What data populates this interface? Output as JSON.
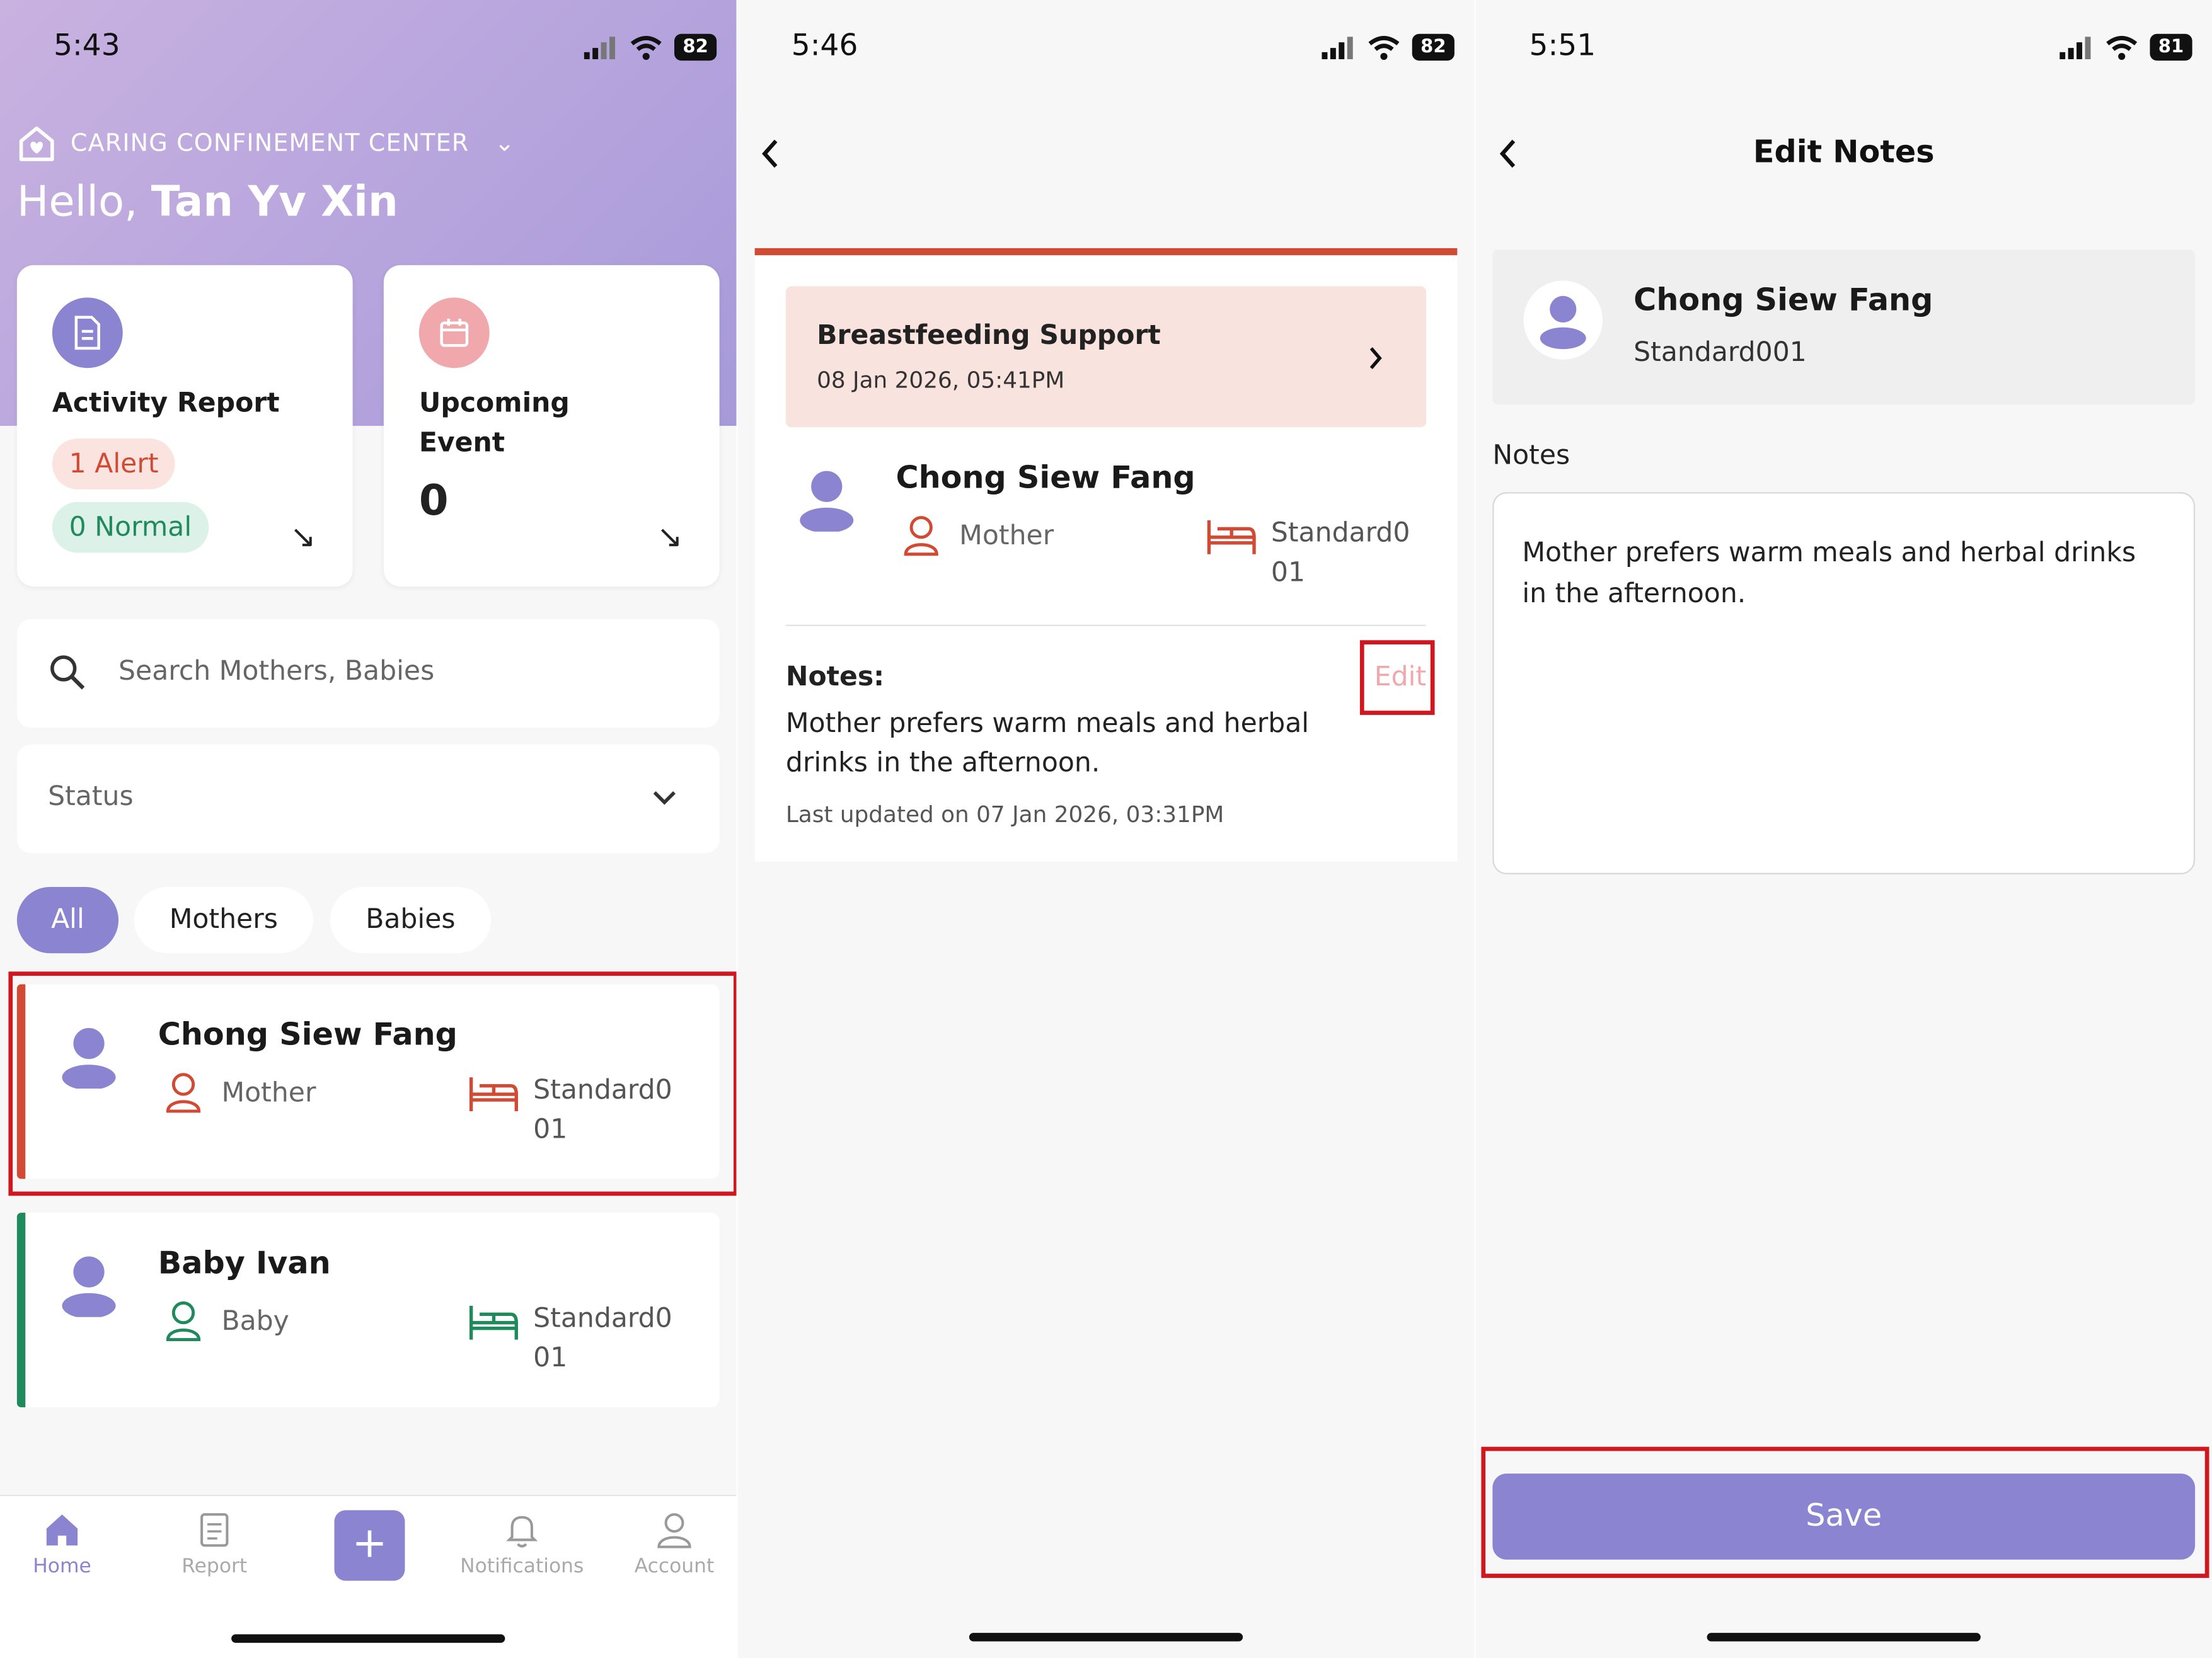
{
  "screens": {
    "home": {
      "time": "5:43",
      "battery": "82",
      "center_name": "CARING CONFINEMENT CENTER",
      "greeting_prefix": "Hello, ",
      "greeting_name": "Tan Yv Xin",
      "activity_report": {
        "title": "Activity Report",
        "alert": "1 Alert",
        "normal": "0 Normal",
        "arrow": "↘"
      },
      "upcoming_event": {
        "title_line1": "Upcoming",
        "title_line2": "Event",
        "count": "0",
        "arrow": "↘"
      },
      "search_placeholder": "Search Mothers, Babies",
      "status_label": "Status",
      "filters": [
        "All",
        "Mothers",
        "Babies"
      ],
      "people": [
        {
          "name": "Chong Siew Fang",
          "role": "Mother",
          "room_line1": "Standard0",
          "room_line2": "01",
          "color": "#d14a33"
        },
        {
          "name": "Baby Ivan",
          "role": "Baby",
          "room_line1": "Standard0",
          "room_line2": "01",
          "color": "#1f8a5b"
        }
      ],
      "tabs": [
        "Home",
        "Report",
        "Notifications",
        "Account"
      ],
      "plus_label": "+"
    },
    "detail": {
      "time": "5:46",
      "battery": "82",
      "event_title": "Breastfeeding Support",
      "event_time": "08 Jan 2026, 05:41PM",
      "name": "Chong Siew Fang",
      "role": "Mother",
      "room_line1": "Standard0",
      "room_line2": "01",
      "notes_label": "Notes:",
      "edit_label": "Edit",
      "notes_text": "Mother prefers warm meals and herbal drinks in the afternoon.",
      "last_updated": "Last updated on 07 Jan 2026, 03:31PM"
    },
    "edit": {
      "time": "5:51",
      "battery": "81",
      "title": "Edit Notes",
      "name": "Chong Siew Fang",
      "room": "Standard001",
      "notes_label": "Notes",
      "notes_value": "Mother prefers warm meals and herbal drinks in the afternoon.",
      "save_label": "Save"
    }
  },
  "colors": {
    "accent": "#8b84d0",
    "mother": "#d14a33",
    "baby": "#1f8a5b",
    "highlight": "#d0171f"
  }
}
